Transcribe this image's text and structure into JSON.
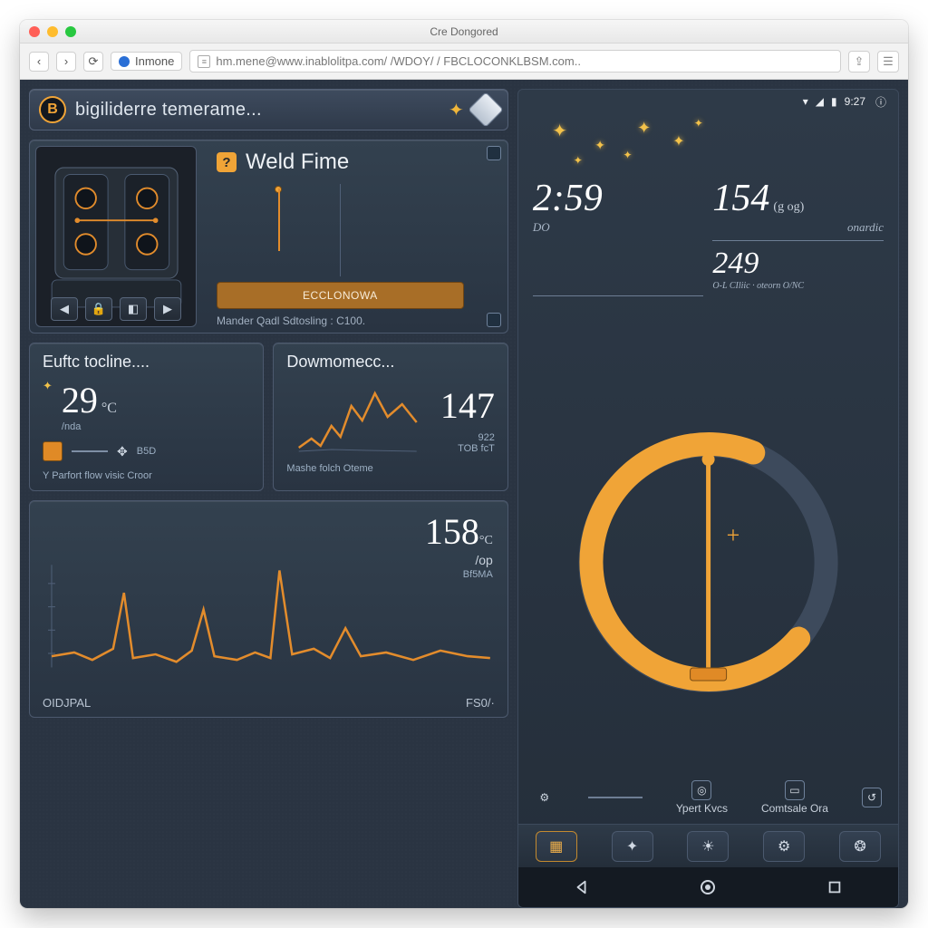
{
  "window": {
    "title": "Cre Dongored",
    "site_label": "Inmone",
    "url": "hm.mene@www.inablolitpa.com/ /WDOY/ / FBCLOCONKLBSM.com.."
  },
  "left": {
    "header": {
      "logo": "B",
      "title": "bigiliderre temerame...",
      "star_glyph": "✦"
    },
    "weld": {
      "title": "Weld Fime",
      "banner": "ECCLONOWA",
      "subtitle": "Mander Qadl Sdtosling : C100."
    },
    "tiles": [
      {
        "title": "Euftc tocline....",
        "value": "29",
        "unit": "°C",
        "subunit": "/nda",
        "badge": "B5D",
        "footer": "Y Parfort flow visic Croor"
      },
      {
        "title": "Dowmomecc...",
        "value": "147",
        "sub_value": "922",
        "sub_label": "TOB fcT",
        "footer": "Mashe folch Oteme"
      }
    ],
    "spectrum": {
      "value": "158",
      "unit": "°C",
      "subunit": "/op",
      "label": "Bf5MA",
      "ticks": [
        "OIDJPAL",
        "FS0/·"
      ]
    }
  },
  "right": {
    "status": {
      "time": "9:27"
    },
    "metrics": {
      "top_left": {
        "value": "2:59",
        "caption": "DO"
      },
      "top_right": {
        "value": "154",
        "sup": "(g og)",
        "caption": "onardic"
      },
      "bottom_right": {
        "value": "249",
        "caption": "O-L CIliic · oteorn O/NC"
      }
    },
    "ring_labels": {
      "left": "Ypert Kvcs",
      "right": "Comtsale Ora"
    },
    "nav_icons": [
      "home",
      "spark",
      "sun",
      "gear",
      "flame"
    ]
  },
  "colors": {
    "accent": "#f0a437",
    "panel_border": "#4c596e"
  },
  "chart_data": {
    "type": "line",
    "title": "158 °C /op  Bf5MA",
    "xlabel": "",
    "ylabel": "",
    "ylim": [
      0,
      100
    ],
    "x": [
      0,
      5,
      10,
      15,
      20,
      25,
      30,
      35,
      40,
      45,
      50,
      55,
      60,
      65,
      70,
      75,
      80,
      85,
      90,
      95,
      100
    ],
    "values": [
      22,
      24,
      20,
      26,
      68,
      21,
      23,
      19,
      24,
      56,
      22,
      20,
      23,
      84,
      25,
      22,
      26,
      40,
      23,
      24,
      21
    ],
    "x_tick_labels": [
      "OIDJPAL",
      "FS0/·"
    ]
  }
}
